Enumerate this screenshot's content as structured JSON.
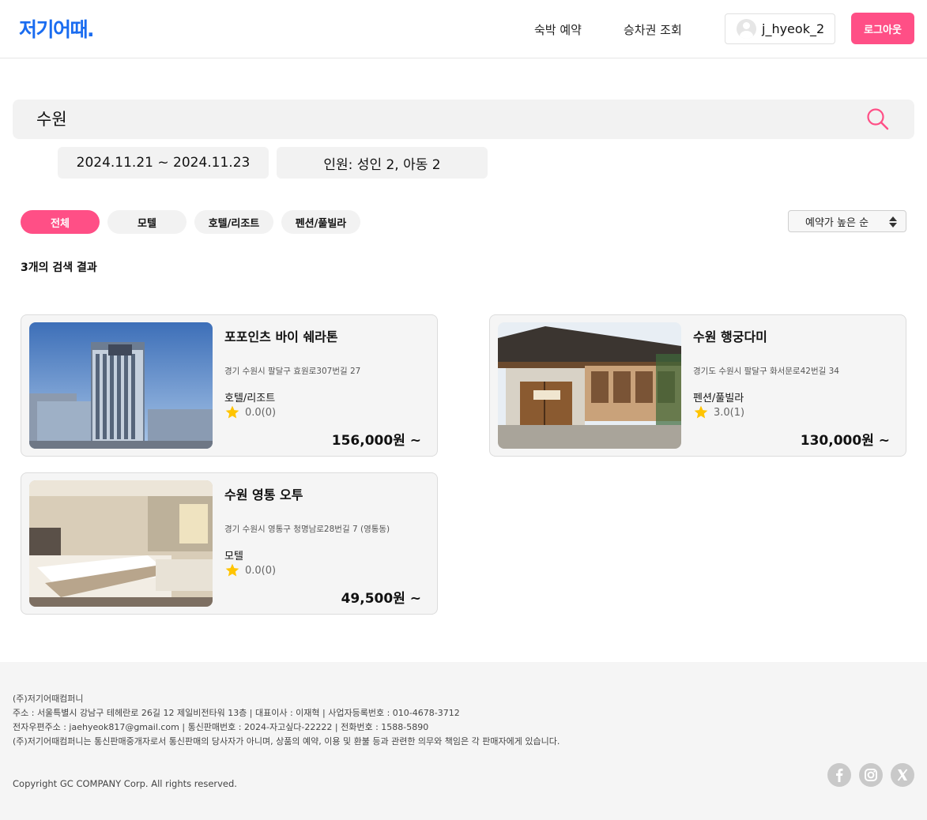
{
  "header": {
    "logo": "저기어때.",
    "nav": [
      "숙박 예약",
      "승차권 조회"
    ],
    "username": "j_hyeok_2",
    "logout_label": "로그아웃"
  },
  "search": {
    "query": "수원",
    "dates": "2024.11.21 ~ 2024.11.23",
    "guests": "인원: 성인 2, 아동 2"
  },
  "filters": {
    "tabs": [
      "전체",
      "모텔",
      "호텔/리조트",
      "펜션/풀빌라"
    ],
    "active_tab": "전체",
    "sort": "예약가 높은 순"
  },
  "results": {
    "count_label": "3개의 검색 결과",
    "items": [
      {
        "name": "포포인츠 바이 쉐라톤",
        "address": "경기 수원시 팔달구 효원로307번길 27",
        "type": "호텔/리조트",
        "rating": "0.0(0)",
        "price": "156,000원 ~"
      },
      {
        "name": "수원 행궁다미",
        "address": "경기도 수원시 팔달구 화서문로42번길 34",
        "type": "펜션/풀빌라",
        "rating": "3.0(1)",
        "price": "130,000원 ~"
      },
      {
        "name": "수원 영통 오투",
        "address": "경기 수원시 영통구 청명남로28번길 7 (영통동)",
        "type": "모텔",
        "rating": "0.0(0)",
        "price": "49,500원 ~"
      }
    ]
  },
  "footer": {
    "company": "(주)저기어때컴퍼니",
    "line1": "주소 : 서울특별시 강남구 테헤란로 26길 12 제일비전타워 13층 | 대표이사 : 이재혁 | 사업자등록번호 : 010-4678-3712",
    "line2": "전자우편주소 : jaehyeok817@gmail.com | 통신판매번호 : 2024-자고싶다-22222 | 전화번호 : 1588-5890",
    "line3": "(주)저기어때컴퍼니는 통신판매중개자로서 통신판매의 당사자가 아니며, 상품의 예약, 이용 및 환불 등과 관련한 의무와 책임은 각 판매자에게 있습니다.",
    "copyright": "Copyright GC COMPANY Corp. All rights reserved.",
    "social_icons": [
      "facebook-icon",
      "instagram-icon",
      "x-icon"
    ]
  },
  "colors": {
    "brand_blue": "#1a6cf0",
    "accent_pink": "#ff4f86",
    "star": "#ffc400"
  }
}
